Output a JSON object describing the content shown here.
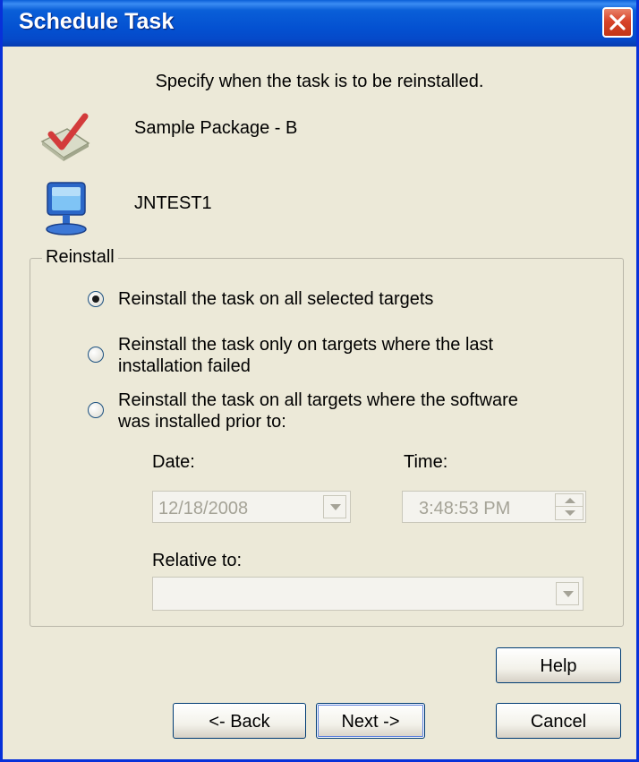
{
  "window": {
    "title": "Schedule Task"
  },
  "instruction": "Specify when the task is to be reinstalled.",
  "package": {
    "name": "Sample Package - B",
    "icon": "checkmark-package-icon"
  },
  "target": {
    "name": "JNTEST1",
    "icon": "computer-monitor-icon"
  },
  "reinstall": {
    "group_label": "Reinstall",
    "options": [
      {
        "line1": "Reinstall the task on all selected targets",
        "line2": "",
        "selected": true
      },
      {
        "line1": "Reinstall the task only on targets where the last",
        "line2": "installation failed",
        "selected": false
      },
      {
        "line1": "Reinstall the task on all targets where the software",
        "line2": "was installed prior to:",
        "selected": false
      }
    ],
    "date_label": "Date:",
    "date_value": "12/18/2008",
    "time_label": "Time:",
    "time_value": "3:48:53 PM",
    "relative_label": "Relative to:",
    "relative_value": ""
  },
  "buttons": {
    "help": "Help",
    "back": "<- Back",
    "next": "Next ->",
    "cancel": "Cancel"
  },
  "colors": {
    "title_bar": "#0a5fd8",
    "dialog_bg": "#ece9d8",
    "close_button": "#d8442a",
    "disabled_text": "#a5a397"
  }
}
